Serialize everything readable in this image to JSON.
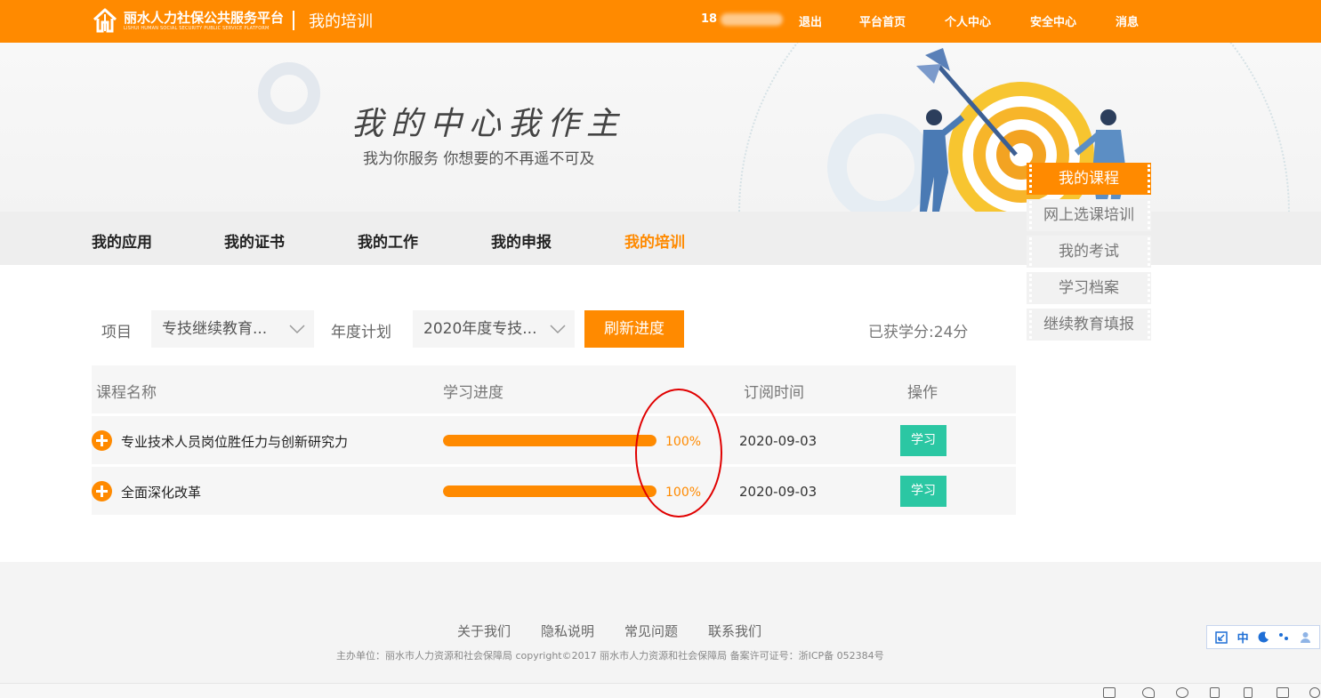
{
  "header": {
    "logo_cn": "丽水人力社保公共服务平台",
    "logo_en": "LISHUI HUMAN SOCIAL SECURITY PUBLIC SERVICE PLATFORM",
    "page_name": "我的培训",
    "user_phone_prefix": "18",
    "links": [
      "退出",
      "平台首页",
      "个人中心",
      "安全中心",
      "消息"
    ],
    "bar_color": "#ff8a00"
  },
  "banner": {
    "slogan_big": "我的中心我作主",
    "slogan_small": "我为你服务 你想要的不再遥不可及"
  },
  "tabs": [
    {
      "label": "我的应用",
      "active": false
    },
    {
      "label": "我的证书",
      "active": false
    },
    {
      "label": "我的工作",
      "active": false
    },
    {
      "label": "我的申报",
      "active": false
    },
    {
      "label": "我的培训",
      "active": true
    }
  ],
  "side_menu": [
    {
      "label": "我的课程",
      "active": true
    },
    {
      "label": "网上选课培训",
      "active": false
    },
    {
      "label": "我的考试",
      "active": false
    },
    {
      "label": "学习档案",
      "active": false
    },
    {
      "label": "继续教育填报",
      "active": false
    }
  ],
  "filters": {
    "project_label": "项目",
    "project_value": "专技继续教育...",
    "plan_label": "年度计划",
    "plan_value": "2020年度专技...",
    "refresh_label": "刷新进度",
    "credits_text": "已获学分:24分"
  },
  "table": {
    "headers": [
      "课程名称",
      "学习进度",
      "订阅时间",
      "操作"
    ],
    "rows": [
      {
        "name": "专业技术人员岗位胜任力与创新研究力",
        "progress": 100,
        "progress_text": "100%",
        "date": "2020-09-03",
        "action": "学习"
      },
      {
        "name": "全面深化改革",
        "progress": 100,
        "progress_text": "100%",
        "date": "2020-09-03",
        "action": "学习"
      }
    ]
  },
  "footer": {
    "links": [
      "关于我们",
      "隐私说明",
      "常见问题",
      "联系我们"
    ],
    "copyright": "主办单位：丽水市人力资源和社会保障局 copyright©2017 丽水市人力资源和社会保障局 备案许可证号：浙ICP备 052384号"
  },
  "ime": {
    "items": [
      "expand-icon",
      "中",
      "moon-icon",
      "punctuation-icon",
      "user-icon"
    ]
  },
  "colors": {
    "accent": "#ff8a00",
    "study_button": "#2bc7a3",
    "annotation_circle": "#e00000"
  }
}
